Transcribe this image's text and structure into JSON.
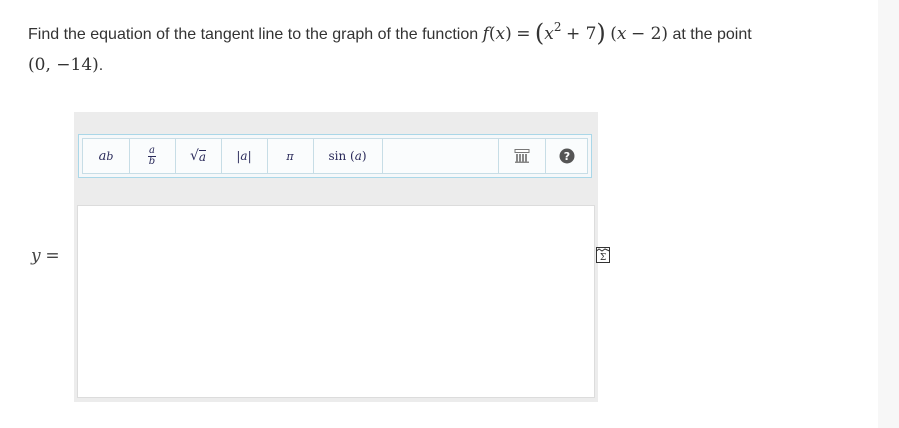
{
  "question": {
    "intro": "Find the equation of the tangent line to the graph of the function",
    "f": "f",
    "x": "x",
    "equals": "=",
    "plus_seven": "+ 7",
    "minus_two": "− 2",
    "at_the_point": "at the point",
    "point": "(0, −14)",
    "period": "."
  },
  "toolbar": {
    "power_base": "a",
    "power_exp": "b",
    "frac_num": "a",
    "frac_den": "b",
    "sqrt_sym": "√",
    "sqrt_arg": "a",
    "abs_label": "|a|",
    "pi_label": "π",
    "sin_label": "sin",
    "sin_arg": "a"
  },
  "answer": {
    "variable": "y",
    "equals": "=",
    "value": ""
  },
  "icons": {
    "keypad": "keypad-icon",
    "help": "help-icon",
    "formula_editor": "formula-editor-icon"
  },
  "colors": {
    "toolbar_border": "#aad7e8",
    "panel_bg": "#ececec",
    "help_circle": "#555555"
  }
}
